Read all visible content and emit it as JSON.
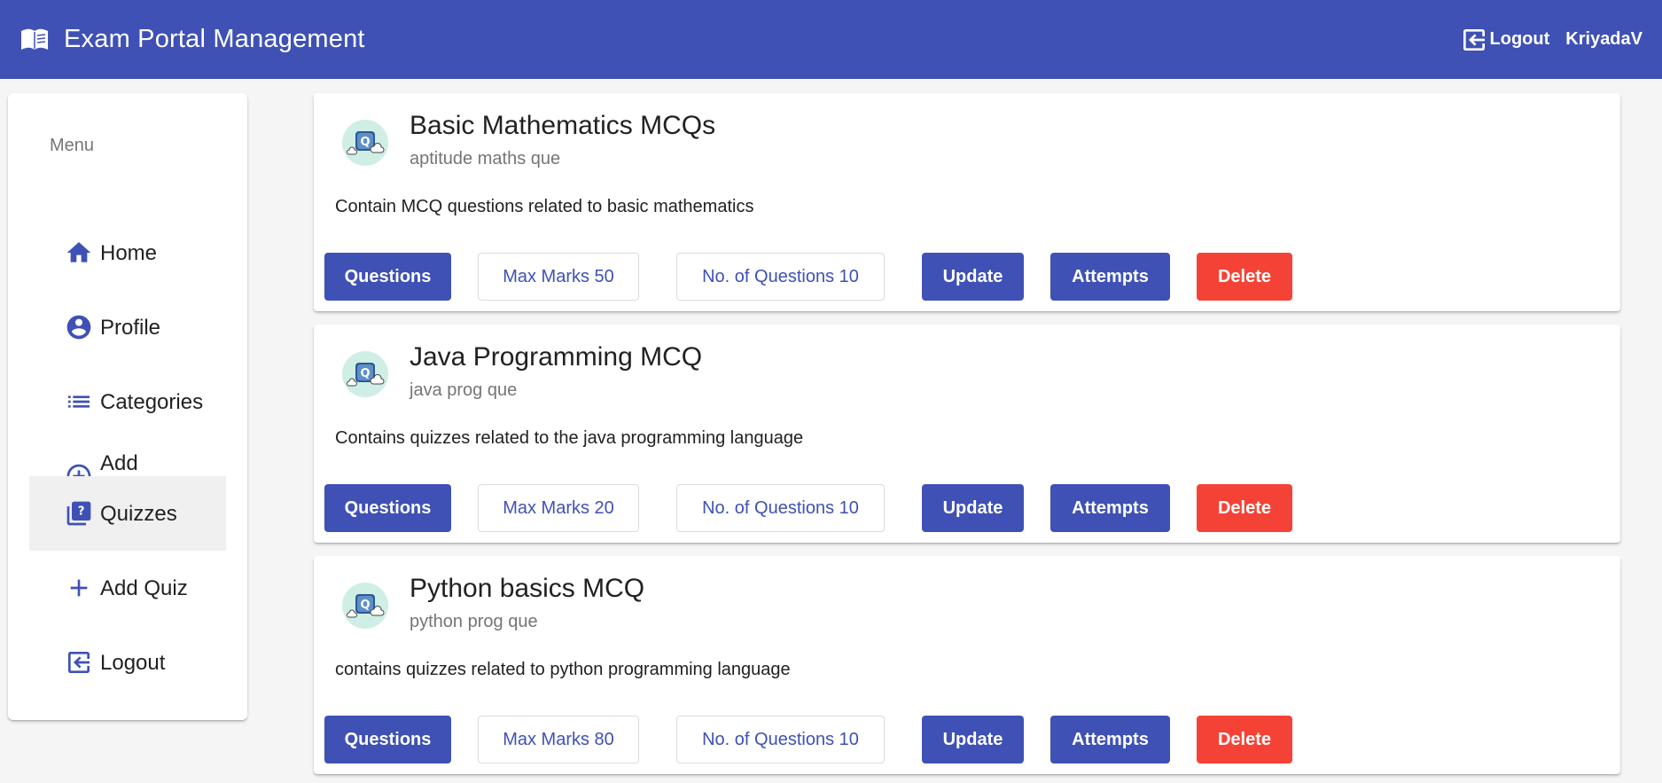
{
  "header": {
    "title": "Exam Portal Management",
    "logout_label": "Logout",
    "username": "KriyadaV",
    "brand_icon": "book-icon",
    "color": "#3f51b5"
  },
  "sidebar": {
    "menu_title": "Menu",
    "items": [
      {
        "label": "Home",
        "icon": "home-icon"
      },
      {
        "label": "Profile",
        "icon": "account-circle-icon"
      },
      {
        "label": "Categories",
        "icon": "list-icon"
      },
      {
        "label": "Add Categories",
        "icon": "add-circle-icon"
      },
      {
        "label": "Quizzes",
        "icon": "quiz-icon",
        "active": true
      },
      {
        "label": "Add Quiz",
        "icon": "plus-icon"
      },
      {
        "label": "Logout",
        "icon": "logout-icon"
      }
    ]
  },
  "quizzes": [
    {
      "title": "Basic Mathematics MCQs",
      "category": "aptitude maths que",
      "description": "Contain MCQ questions related to basic mathematics",
      "questions_label": "Questions",
      "max_marks_label": "Max Marks 50",
      "num_questions_label": "No. of Questions 10",
      "update_label": "Update",
      "attempts_label": "Attempts",
      "delete_label": "Delete"
    },
    {
      "title": "Java Programming MCQ",
      "category": "java prog que",
      "description": "Contains quizzes related to the java programming language",
      "questions_label": "Questions",
      "max_marks_label": "Max Marks 20",
      "num_questions_label": "No. of Questions 10",
      "update_label": "Update",
      "attempts_label": "Attempts",
      "delete_label": "Delete"
    },
    {
      "title": "Python basics MCQ",
      "category": "python prog que",
      "description": "contains quizzes related to python programming language",
      "questions_label": "Questions",
      "max_marks_label": "Max Marks 80",
      "num_questions_label": "No. of Questions 10",
      "update_label": "Update",
      "attempts_label": "Attempts",
      "delete_label": "Delete"
    }
  ],
  "colors": {
    "primary": "#3f51b5",
    "warn": "#f44336",
    "background": "#f5f5f5"
  }
}
